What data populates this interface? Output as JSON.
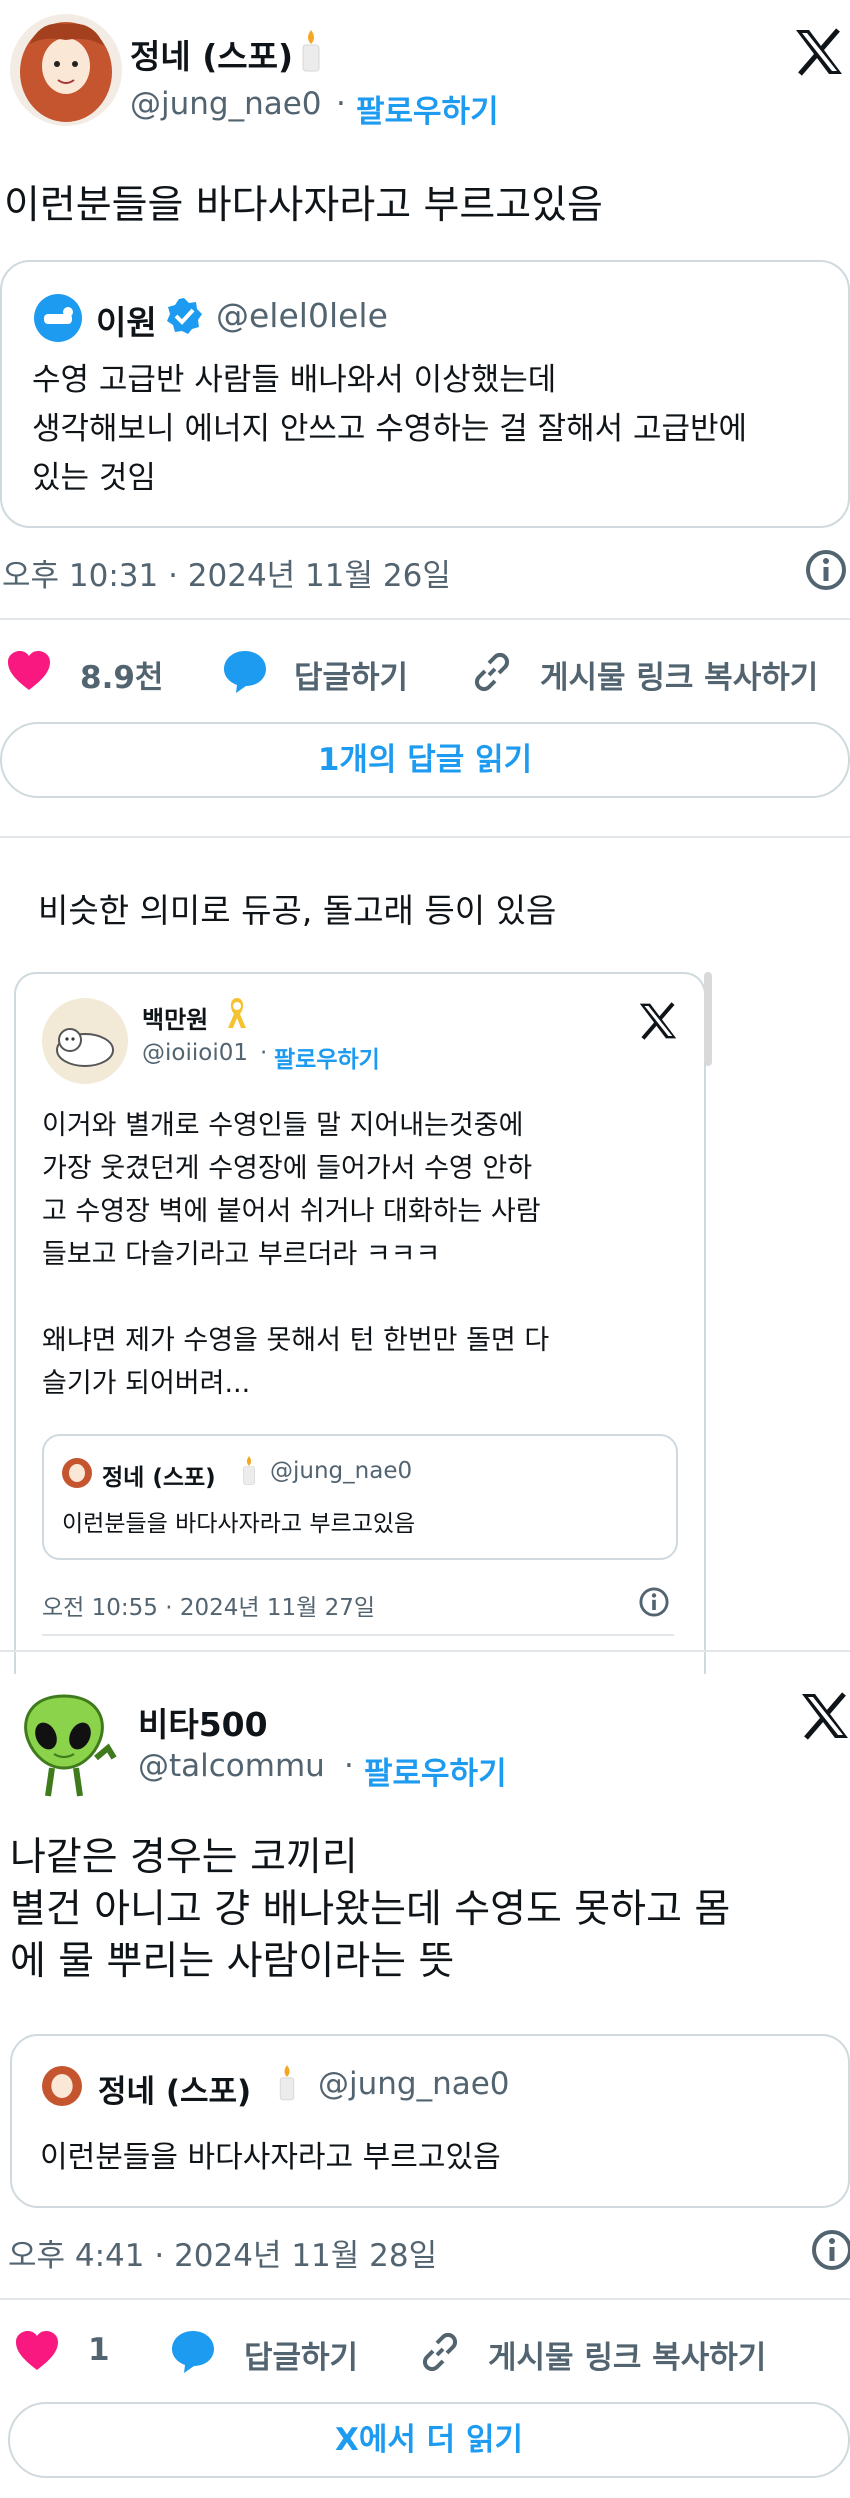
{
  "tweet1": {
    "author": "정네 (스포)",
    "handle": "@jung_nae0",
    "sep": "·",
    "follow": "팔로우하기",
    "text": "이런분들을 바다사자라고 부르고있음",
    "quote": {
      "author": "이원",
      "handle": "@elel0lele",
      "text": "수영 고급반 사람들 배나와서 이상했는데\n생각해보니 에너지 안쓰고 수영하는 걸 잘해서 고급반에\n있는 것임"
    },
    "timestamp": "오후 10:31 · 2024년 11월 26일",
    "likes": "8.9천",
    "reply_label": "답글하기",
    "copy_link_label": "게시물 링크 복사하기",
    "read_replies": "1개의 답글 읽기"
  },
  "middle_text": "비슷한 의미로 듀공, 돌고래 등이 있음",
  "tweet2": {
    "author": "백만원",
    "handle": "@ioiioi01",
    "sep": "·",
    "follow": "팔로우하기",
    "text": "이거와 별개로 수영인들 말 지어내는것중에\n가장 웃겼던게 수영장에 들어가서 수영 안하\n고 수영장 벽에 붙어서 쉬거나 대화하는 사람\n들보고 다슬기라고 부르더라 ㅋㅋㅋ\n\n왜냐면 제가 수영을 못해서 턴 한번만 돌면 다\n슬기가 되어버려...",
    "quote": {
      "author": "정네 (스포)",
      "handle": "@jung_nae0",
      "text": "이런분들을 바다사자라고 부르고있음"
    },
    "timestamp": "오전 10:55 · 2024년 11월 27일"
  },
  "tweet3": {
    "author": "비타500",
    "handle": "@talcommu",
    "sep": "·",
    "follow": "팔로우하기",
    "text": "나같은 경우는 코끼리\n별건 아니고 걍 배나왔는데 수영도 못하고 몸\n에 물 뿌리는 사람이라는 뜻",
    "quote": {
      "author": "정네 (스포)",
      "handle": "@jung_nae0",
      "text": "이런분들을 바다사자라고 부르고있음"
    },
    "timestamp": "오후 4:41 · 2024년 11월 28일",
    "likes": "1",
    "reply_label": "답글하기",
    "copy_link_label": "게시물 링크 복사하기",
    "read_more": "X에서 더 읽기"
  },
  "colors": {
    "accent": "#1d9bf0",
    "like": "#f91880",
    "text": "#0f1419",
    "muted": "#536471",
    "border": "#cfd9de"
  },
  "icons": [
    "x-logo-icon",
    "candle-icon",
    "verified-badge-icon",
    "heart-icon",
    "reply-bubble-icon",
    "link-icon",
    "info-icon",
    "ribbon-icon"
  ]
}
